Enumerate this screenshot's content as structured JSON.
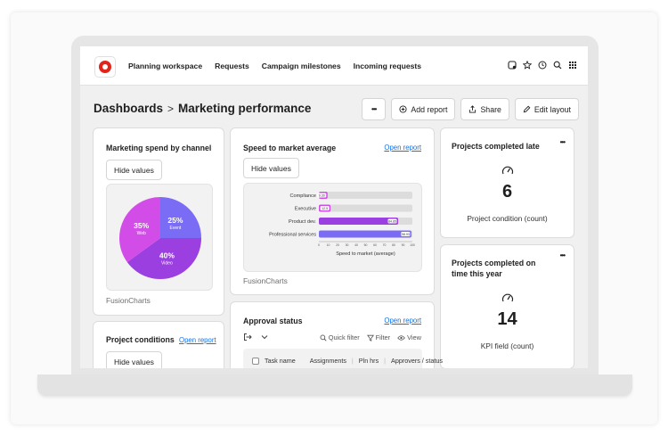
{
  "nav": {
    "items": [
      "Planning workspace",
      "Requests",
      "Campaign milestones",
      "Incoming requests"
    ]
  },
  "top_icons": [
    "notification-icon",
    "star-icon",
    "clock-icon",
    "search-icon",
    "grid-icon"
  ],
  "breadcrumb": {
    "parent": "Dashboards",
    "separator": ">",
    "current": "Marketing performance"
  },
  "header_buttons": {
    "more": "•••",
    "add_report": "Add report",
    "share": "Share",
    "edit_layout": "Edit layout"
  },
  "spend_card": {
    "title": "Marketing spend by channel",
    "hide_values": "Hide values",
    "footer": "FusionCharts",
    "chart_data": {
      "type": "pie",
      "categories": [
        "Event",
        "Video",
        "Web"
      ],
      "values": [
        25,
        40,
        35
      ],
      "labels": [
        "25%",
        "40%",
        "35%"
      ],
      "colors": [
        "#7b6cf6",
        "#9b3fe0",
        "#d24ce8"
      ]
    }
  },
  "speed_card": {
    "title": "Speed to market average",
    "link": "Open report",
    "hide_values": "Hide values",
    "footer": "FusionCharts",
    "chart_data": {
      "type": "bar",
      "orientation": "horizontal",
      "categories": [
        "Compliance",
        "Executive",
        "Product dev.",
        "Professional services"
      ],
      "values": [
        9.3,
        12.5,
        84.8,
        98.9
      ],
      "value_labels": [
        "9.30",
        "12.5",
        "84.85",
        "98.93"
      ],
      "colors": [
        "#d24ce8",
        "#d24ce8",
        "#9b3fe0",
        "#7b6cf6"
      ],
      "xlim": [
        0,
        100
      ],
      "ticks": [
        "0",
        "10",
        "20",
        "30",
        "40",
        "50",
        "60",
        "70",
        "80",
        "90",
        "100"
      ],
      "xlabel": "Speed to market (average)"
    }
  },
  "late_card": {
    "title": "Projects completed late",
    "more": "•••",
    "value": "6",
    "label": "Project condition (count)"
  },
  "year_card": {
    "title_line1": "Projects completed on",
    "title_line2": "time this year",
    "more": "•••",
    "value": "14",
    "label": "KPI field (count)"
  },
  "conditions_card": {
    "title": "Project conditions",
    "link": "Open report",
    "hide_values": "Hide values"
  },
  "approval_card": {
    "title": "Approval status",
    "link": "Open report",
    "quick_filter": "Quick filter",
    "filter": "Filter",
    "view": "View",
    "columns": [
      "Task name",
      "Assignments",
      "Pln hrs",
      "Approvers / status"
    ]
  }
}
